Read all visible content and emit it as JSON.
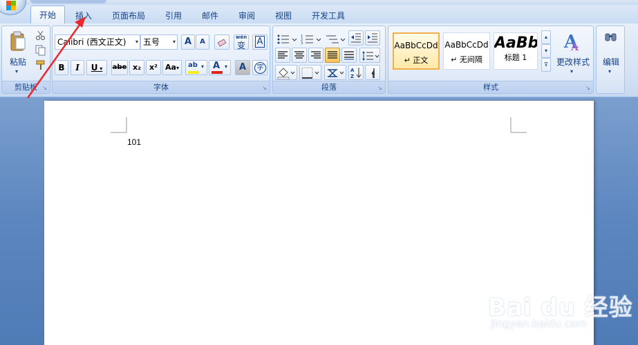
{
  "tabs": [
    "开始",
    "插入",
    "页面布局",
    "引用",
    "邮件",
    "审阅",
    "视图",
    "开发工具"
  ],
  "active_tab": "开始",
  "clipboard": {
    "paste_label": "粘贴",
    "group_label": "剪贴板"
  },
  "font": {
    "name_value": "Calibri (西文正文)",
    "size_value": "五号",
    "grow_label": "A",
    "shrink_label": "A",
    "wen_label": "wén",
    "wen_char": "变",
    "border_char_label": "A",
    "bold_label": "B",
    "italic_label": "I",
    "underline_label": "U",
    "strike_label": "abe",
    "sub_label": "x₂",
    "sup_label": "x²",
    "case_label": "Aa",
    "highlight_label": "ab",
    "color_label": "A",
    "shade_label": "A",
    "circle_label": "字",
    "group_label": "字体"
  },
  "paragraph": {
    "group_label": "段落"
  },
  "styles": {
    "tiles": [
      {
        "sample": "AaBbCcDd",
        "name": "↵ 正文"
      },
      {
        "sample": "AaBbCcDd",
        "name": "↵ 无间隔"
      },
      {
        "sample": "AaBb",
        "name": "标题 1"
      }
    ],
    "change_label": "更改样式",
    "group_label": "样式"
  },
  "editing": {
    "label": "编辑"
  },
  "document": {
    "text": "101"
  },
  "watermark": {
    "main": "Bai du 经验",
    "sub": "jingyan.baidu.com"
  },
  "colors": {
    "annotation_arrow": "#e8292e",
    "highlight": "#f8ea1d",
    "font_color": "#e2231a"
  }
}
